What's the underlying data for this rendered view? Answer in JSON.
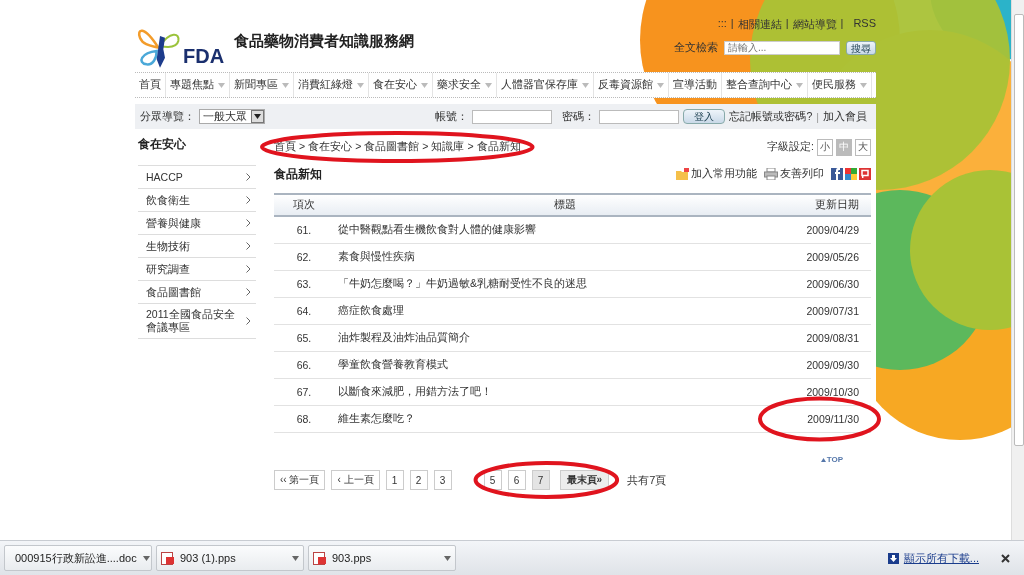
{
  "header": {
    "site_title": "食品藥物消費者知識服務網",
    "logo_text": "FDA",
    "top_links": {
      "items": [
        ":::",
        "相關連結",
        "網站導覽",
        "RSS"
      ],
      "separator": "|"
    },
    "search": {
      "label": "全文檢索",
      "placeholder": "請輸入...",
      "button": "搜尋"
    }
  },
  "nav": [
    {
      "label": "首頁",
      "dropdown": false
    },
    {
      "label": "專題焦點",
      "dropdown": true
    },
    {
      "label": "新聞專區",
      "dropdown": true
    },
    {
      "label": "消費紅綠燈",
      "dropdown": true
    },
    {
      "label": "食在安心",
      "dropdown": true
    },
    {
      "label": "藥求安全",
      "dropdown": true
    },
    {
      "label": "人體器官保存庫",
      "dropdown": true
    },
    {
      "label": "反毒資源館",
      "dropdown": true
    },
    {
      "label": "宣導活動",
      "dropdown": false
    },
    {
      "label": "整合查詢中心",
      "dropdown": true
    },
    {
      "label": "便民服務",
      "dropdown": true
    }
  ],
  "login": {
    "category_label": "分眾導覽：",
    "category_value": "一般大眾",
    "account_label": "帳號：",
    "password_label": "密碼：",
    "login_button": "登入",
    "forgot_link": "忘記帳號或密碼?",
    "join_link": "加入會員"
  },
  "sidebar": {
    "title": "食在安心",
    "items": [
      "HACCP",
      "飲食衛生",
      "營養與健康",
      "生物技術",
      "研究調查",
      "食品圖書館",
      "2011全國食品安全會議專區"
    ]
  },
  "breadcrumb": {
    "items": [
      "首頁",
      "食在安心",
      "食品圖書館",
      "知識庫",
      "食品新知"
    ],
    "separator": ">",
    "annotated": true
  },
  "font_size": {
    "label": "字級設定:",
    "sizes": [
      {
        "label": "小",
        "selected": false
      },
      {
        "label": "中",
        "selected": true
      },
      {
        "label": "大",
        "selected": false
      }
    ]
  },
  "page_title": "食品新知",
  "tools": [
    {
      "kind": "favorite",
      "label": "加入常用功能"
    },
    {
      "kind": "print",
      "label": "友善列印"
    }
  ],
  "table": {
    "columns": [
      "項次",
      "標題",
      "更新日期"
    ],
    "rows": [
      {
        "no": "61.",
        "title": "從中醫觀點看生機飲食對人體的健康影響",
        "date": "2009/04/29",
        "annotated": false
      },
      {
        "no": "62.",
        "title": "素食與慢性疾病",
        "date": "2009/05/26",
        "annotated": false
      },
      {
        "no": "63.",
        "title": "「牛奶怎麼喝？」牛奶過敏&乳糖耐受性不良的迷思",
        "date": "2009/06/30",
        "annotated": false
      },
      {
        "no": "64.",
        "title": "癌症飲食處理",
        "date": "2009/07/31",
        "annotated": false
      },
      {
        "no": "65.",
        "title": "油炸製程及油炸油品質簡介",
        "date": "2009/08/31",
        "annotated": false
      },
      {
        "no": "66.",
        "title": "學童飲食營養教育模式",
        "date": "2009/09/30",
        "annotated": false
      },
      {
        "no": "67.",
        "title": "以斷食來減肥，用錯方法了吧！",
        "date": "2009/10/30",
        "annotated": false
      },
      {
        "no": "68.",
        "title": "維生素怎麼吃？",
        "date": "2009/11/30",
        "annotated": true
      }
    ]
  },
  "top_link": "TOP",
  "pagination": {
    "first": "‹‹ 第一頁",
    "prev": "‹ 上一頁",
    "pages": [
      {
        "label": "1",
        "selected": false,
        "annotated": false
      },
      {
        "label": "2",
        "selected": false,
        "annotated": false
      },
      {
        "label": "3",
        "selected": false,
        "annotated": false
      },
      {
        "label": "5",
        "selected": false,
        "annotated": true
      },
      {
        "label": "6",
        "selected": false,
        "annotated": true
      },
      {
        "label": "7",
        "selected": true,
        "annotated": true
      }
    ],
    "last": {
      "label": "最末頁»",
      "annotated": true
    },
    "total": "共有7頁"
  },
  "downloads": {
    "items": [
      {
        "name": "000915行政新訟進....doc",
        "kind": "doc"
      },
      {
        "name": "903 (1).pps",
        "kind": "pps"
      },
      {
        "name": "903.pps",
        "kind": "pps"
      }
    ],
    "show_all": "顯示所有下載..."
  }
}
